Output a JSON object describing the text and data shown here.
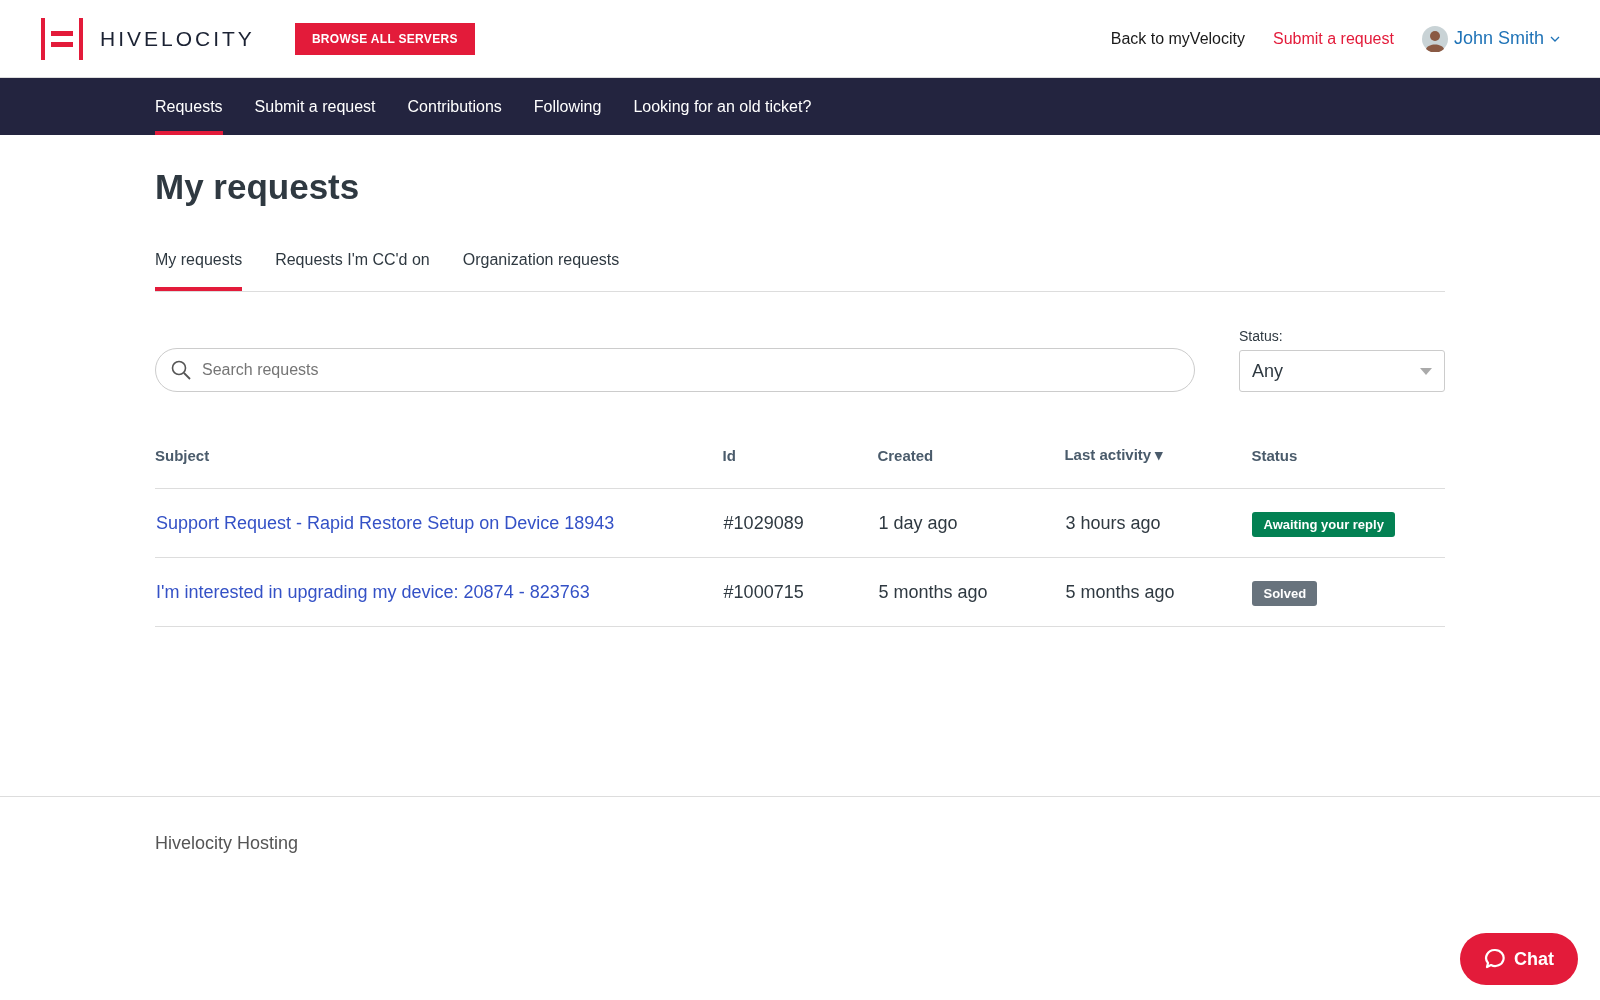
{
  "header": {
    "brand": "HIVELOCITY",
    "cta": "BROWSE ALL SERVERS",
    "links": [
      {
        "label": "Back to myVelocity",
        "kind": "plain"
      },
      {
        "label": "Submit a request",
        "kind": "accent"
      }
    ],
    "user": "John Smith"
  },
  "nav": [
    {
      "label": "Requests",
      "selected": true
    },
    {
      "label": "Submit a request",
      "selected": false
    },
    {
      "label": "Contributions",
      "selected": false
    },
    {
      "label": "Following",
      "selected": false
    },
    {
      "label": "Looking for an old ticket?",
      "selected": false
    }
  ],
  "page_title": "My requests",
  "tabs": [
    {
      "label": "My requests",
      "selected": true
    },
    {
      "label": "Requests I'm CC'd on",
      "selected": false
    },
    {
      "label": "Organization requests",
      "selected": false
    }
  ],
  "search": {
    "placeholder": "Search requests"
  },
  "status_filter": {
    "label": "Status:",
    "value": "Any"
  },
  "table": {
    "columns": [
      "Subject",
      "Id",
      "Created",
      "Last activity ▾",
      "Status"
    ],
    "rows": [
      {
        "subject": "Support Request - Rapid Restore Setup on Device 18943",
        "id": "#1029089",
        "created": "1 day ago",
        "last_activity": "3 hours ago",
        "status": "Awaiting your reply",
        "color": "#038153"
      },
      {
        "subject": "I'm interested in upgrading my device: 20874 - 823763",
        "id": "#1000715",
        "created": "5 months ago",
        "last_activity": "5 months ago",
        "status": "Solved",
        "color": "#68737d"
      }
    ]
  },
  "footer": {
    "text": "Hivelocity Hosting"
  },
  "chat": {
    "label": "Chat"
  }
}
